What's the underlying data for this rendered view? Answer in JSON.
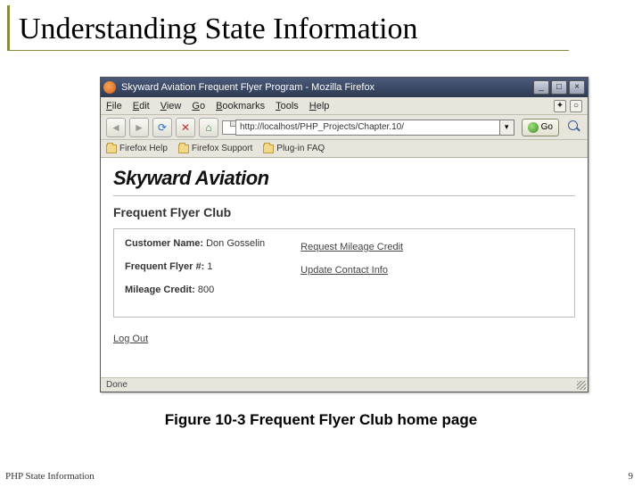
{
  "slide": {
    "title": "Understanding State Information",
    "caption": "Figure 10-3 Frequent Flyer Club home page",
    "footer_left": "PHP State Information",
    "footer_right": "9"
  },
  "browser": {
    "window_title": "Skyward Aviation Frequent Flyer Program - Mozilla Firefox",
    "menus": {
      "file": "File",
      "edit": "Edit",
      "view": "View",
      "go": "Go",
      "bookmarks": "Bookmarks",
      "tools": "Tools",
      "help": "Help"
    },
    "url": "http://localhost/PHP_Projects/Chapter.10/",
    "go_label": "Go",
    "bookmarks": {
      "help": "Firefox Help",
      "support": "Firefox Support",
      "plugin": "Plug-in FAQ"
    },
    "status": "Done"
  },
  "page": {
    "site_title": "Skyward Aviation",
    "section": "Frequent Flyer Club",
    "labels": {
      "customer_name": "Customer Name:",
      "ff_number": "Frequent Flyer #:",
      "mileage_credit": "Mileage Credit:"
    },
    "values": {
      "customer_name": "Don Gosselin",
      "ff_number": "1",
      "mileage_credit": "800"
    },
    "links": {
      "request_mileage": "Request Mileage Credit",
      "update_contact": "Update Contact Info",
      "logout": "Log Out"
    }
  }
}
